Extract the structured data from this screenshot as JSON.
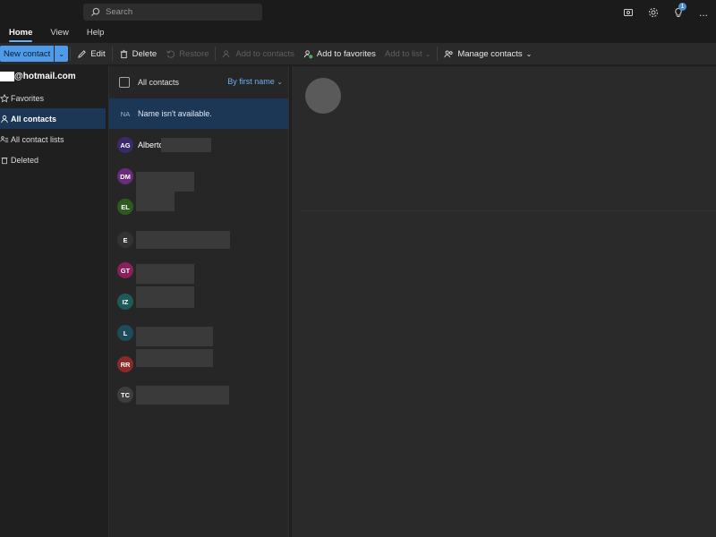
{
  "titlebar": {
    "search_placeholder": "Search",
    "notification_count": "1",
    "more_label": "..."
  },
  "tabs": [
    {
      "label": "Home",
      "active": true
    },
    {
      "label": "View",
      "active": false
    },
    {
      "label": "Help",
      "active": false
    }
  ],
  "commands": {
    "new_contact": "New contact",
    "edit": "Edit",
    "delete": "Delete",
    "restore": "Restore",
    "add_to_contacts": "Add to contacts",
    "add_to_favorites": "Add to favorites",
    "add_to_list": "Add to list",
    "manage_contacts": "Manage contacts"
  },
  "nav": {
    "account": "@hotmail.com",
    "items": [
      {
        "label": "Favorites",
        "icon": "star-icon"
      },
      {
        "label": "All contacts",
        "icon": "person-icon",
        "selected": true
      },
      {
        "label": "All contact lists",
        "icon": "contact-list-icon"
      },
      {
        "label": "Deleted",
        "icon": "trash-icon"
      }
    ]
  },
  "list": {
    "header": "All contacts",
    "sort_label": "By first name",
    "rows": [
      {
        "initials": "NA",
        "name": "Name isn't available.",
        "color": "#1c3656",
        "selected": true
      },
      {
        "initials": "AG",
        "name": "Alberto",
        "color": "#3b2a6b"
      },
      {
        "initials": "DM",
        "name": "",
        "color": "#6a2c7a"
      },
      {
        "initials": "EL",
        "name": "",
        "color": "#2e5a1f"
      },
      {
        "initials": "E",
        "name": "",
        "color": "#3a3a3a"
      },
      {
        "initials": "GT",
        "name": "",
        "color": "#8a1f5a"
      },
      {
        "initials": "IZ",
        "name": "",
        "color": "#1f5a5a"
      },
      {
        "initials": "L",
        "name": "",
        "color": "#1f4a5a"
      },
      {
        "initials": "RR",
        "name": "",
        "color": "#8a2a2a"
      },
      {
        "initials": "TC",
        "name": "",
        "color": "#3e3e3e"
      }
    ]
  },
  "colors": {
    "accent": "#4f9be8",
    "selected_bg": "#1c3656",
    "link": "#6ab0f5"
  }
}
